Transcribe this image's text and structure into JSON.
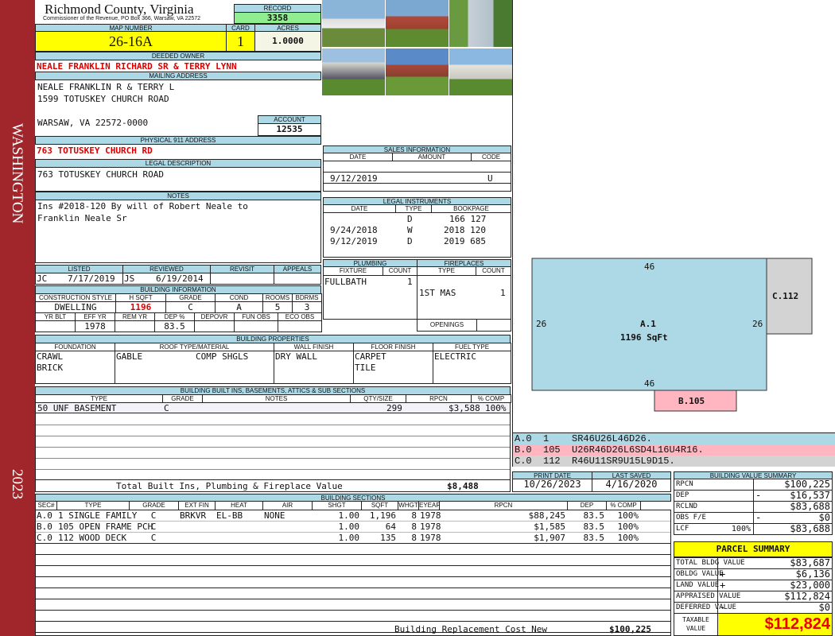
{
  "sidebar": {
    "top": "WASHINGTON",
    "bottom": "2023"
  },
  "header": {
    "title": "Richmond County, Virginia",
    "subtitle": "Commissioner of the Revenue, PO Box 366, Warsaw, VA 22572",
    "record_label": "RECORD",
    "record": "3358",
    "map_label": "MAP NUMBER",
    "map": "26-16A",
    "card_label": "CARD",
    "card": "1",
    "acres_label": "ACRES",
    "acres": "1.0000"
  },
  "owner": {
    "label": "DEEDED OWNER",
    "value": "NEALE FRANKLIN RICHARD SR & TERRY LYNN"
  },
  "mailing": {
    "label": "MAILING ADDRESS",
    "line1": "NEALE FRANKLIN R & TERRY L",
    "line2": "1599 TOTUSKEY CHURCH ROAD",
    "line3": "WARSAW, VA 22572-0000"
  },
  "account": {
    "label": "ACCOUNT",
    "value": "12535"
  },
  "physical": {
    "label": "PHYSICAL 911 ADDRESS",
    "value": "763 TOTUSKEY CHURCH RD"
  },
  "legal": {
    "label": "LEGAL DESCRIPTION",
    "value": "763 TOTUSKEY CHURCH ROAD"
  },
  "notes": {
    "label": "NOTES",
    "line1": "Ins #2018-120 By will of Robert Neale to",
    "line2": "Franklin Neale Sr"
  },
  "sales": {
    "label": "SALES INFORMATION",
    "cols": [
      "DATE",
      "AMOUNT",
      "CODE"
    ],
    "rows": [
      {
        "date": "9/12/2019",
        "amount": "",
        "code": "U"
      }
    ]
  },
  "instruments": {
    "label": "LEGAL INSTRUMENTS",
    "cols": [
      "DATE",
      "TYPE",
      "BOOKPAGE"
    ],
    "rows": [
      {
        "date": "",
        "type": "D",
        "book": "166 127"
      },
      {
        "date": "9/24/2018",
        "type": "W",
        "book": "2018 120"
      },
      {
        "date": "9/12/2019",
        "type": "D",
        "book": "2019 685"
      }
    ]
  },
  "listing": {
    "cols": [
      "LISTED",
      "REVIEWED",
      "REVISIT",
      "APPEALS"
    ],
    "listed_by": "JC",
    "listed": "7/17/2019",
    "reviewed_by": "JS",
    "reviewed": "6/19/2014"
  },
  "plumbing": {
    "label": "PLUMBING",
    "cols": [
      "FIXTURE",
      "COUNT"
    ],
    "fixture": "FULLBATH",
    "count": "1"
  },
  "fireplaces": {
    "label": "FIREPLACES",
    "cols": [
      "TYPE",
      "COUNT"
    ],
    "type": "1ST MAS",
    "count": "1",
    "openings": "OPENINGS"
  },
  "building_info": {
    "label": "BUILDING INFORMATION",
    "cols1": [
      "CONSTRUCTION STYLE",
      "H SQFT",
      "GRADE",
      "COND",
      "ROOMS",
      "BDRMS"
    ],
    "vals1": [
      "DWELLING",
      "1196",
      "C",
      "A",
      "5",
      "3"
    ],
    "cols2": [
      "YR BLT",
      "EFF YR",
      "REM YR",
      "DEP %",
      "DEPOVR",
      "FUN OBS",
      "ECO OBS"
    ],
    "vals2": [
      "",
      "1978",
      "",
      "83.5",
      "",
      "",
      ""
    ]
  },
  "properties": {
    "label": "BUILDING PROPERTIES",
    "cols": [
      "FOUNDATION",
      "ROOF TYPE/MATERIAL",
      "WALL FINISH",
      "FLOOR FINISH",
      "FUEL TYPE"
    ],
    "foundation1": "CRAWL",
    "foundation2": "BRICK",
    "roof1": "GABLE",
    "roof2": "COMP SHGLS",
    "wall": "DRY WALL",
    "floor1": "CARPET",
    "floor2": "TILE",
    "fuel": "ELECTRIC"
  },
  "builtins": {
    "label": "BUILDING BUILT INS, BASEMENTS, ATTICS & SUB SECTIONS",
    "cols": [
      "TYPE",
      "GRADE",
      "NOTES",
      "QTY/SIZE",
      "RPCN",
      "% COMP"
    ],
    "row": {
      "type": "50 UNF BASEMENT",
      "grade": "C",
      "notes": "",
      "qty": "299",
      "rpcn": "$3,588",
      "comp": "100%"
    },
    "total_label": "Total Built Ins, Plumbing & Fireplace Value",
    "total": "$8,488"
  },
  "sections": {
    "label": "BUILDING SECTIONS",
    "cols": [
      "SEC#",
      "TYPE",
      "GRADE",
      "EXT FIN",
      "HEAT",
      "AIR",
      "SHGT",
      "SQFT",
      "WHGT",
      "EYEAR",
      "RPCN",
      "DEP",
      "% COMP"
    ],
    "rows": [
      [
        "A.0",
        "1 SINGLE FAMILY",
        "C",
        "BRKVR",
        "EL-BB",
        "NONE",
        "1.00",
        "1,196",
        "8",
        "1978",
        "$88,245",
        "83.5",
        "100%"
      ],
      [
        "B.0",
        "105 OPEN FRAME PCH",
        "C",
        "",
        "",
        "",
        "1.00",
        "64",
        "8",
        "1978",
        "$1,585",
        "83.5",
        "100%"
      ],
      [
        "C.0",
        "112 WOOD DECK",
        "C",
        "",
        "",
        "",
        "1.00",
        "135",
        "8",
        "1978",
        "$1,907",
        "83.5",
        "100%"
      ]
    ],
    "total_label": "Building Replacement Cost New",
    "total": "$100,225"
  },
  "sketch": {
    "a_label": "A.1",
    "a_area": "1196 SqFt",
    "c_label": "C.112",
    "b_label": "B.105",
    "dims": [
      "46",
      "26",
      "26",
      "46"
    ],
    "legend": [
      {
        "sec": "A.0",
        "code": "1",
        "path": "SR46U26L46D26.",
        "color": "#add8e6"
      },
      {
        "sec": "B.0",
        "code": "105",
        "path": "U26R46D26L6SD4L16U4R16.",
        "color": "#ffb6c1"
      },
      {
        "sec": "C.0",
        "code": "112",
        "path": "R46U11SR9U15L9D15.",
        "color": "#d3d3d3"
      }
    ]
  },
  "dates": {
    "print_label": "PRINT DATE",
    "print": "10/26/2023",
    "saved_label": "LAST SAVED",
    "saved": "4/16/2020"
  },
  "value_summary": {
    "label": "BUILDING VALUE SUMMARY",
    "rows": [
      {
        "k": "RPCN",
        "s": "",
        "v": "$100,225"
      },
      {
        "k": "DEP",
        "s": "-",
        "v": "$16,537"
      },
      {
        "k": "RCLND",
        "s": "",
        "v": "$83,688"
      },
      {
        "k": "OBS F/E",
        "s": "-",
        "v": "$0"
      },
      {
        "k": "LCF",
        "p": "100%",
        "s": "",
        "v": "$83,688"
      }
    ]
  },
  "parcel": {
    "label": "PARCEL SUMMARY",
    "rows": [
      {
        "k": "TOTAL BLDG VALUE",
        "s": "",
        "v": "$83,687"
      },
      {
        "k": "OBLDG VALUE",
        "s": "+",
        "v": "$6,136"
      },
      {
        "k": "LAND VALUE",
        "s": "+",
        "v": "$23,000"
      },
      {
        "k": "APPRAISED VALUE",
        "s": "",
        "v": "$112,824"
      },
      {
        "k": "DEFERRED VALUE",
        "s": "-",
        "v": "$0"
      }
    ],
    "taxable_label": "TAXABLE VALUE",
    "taxable": "$112,824"
  }
}
